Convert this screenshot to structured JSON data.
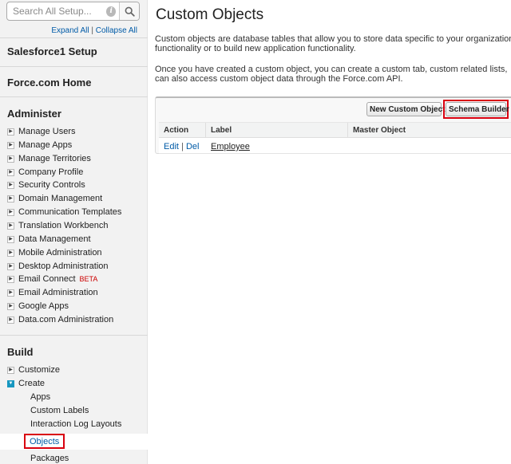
{
  "sidebar": {
    "search_placeholder": "Search All Setup...",
    "expand_all": "Expand All",
    "separator": " | ",
    "collapse_all": "Collapse All",
    "sections": {
      "salesforce1": "Salesforce1 Setup",
      "forcecom": "Force.com Home",
      "administer": "Administer",
      "build": "Build"
    },
    "administer_items": [
      "Manage Users",
      "Manage Apps",
      "Manage Territories",
      "Company Profile",
      "Security Controls",
      "Domain Management",
      "Communication Templates",
      "Translation Workbench",
      "Data Management",
      "Mobile Administration",
      "Desktop Administration",
      "Email Connect",
      "Email Administration",
      "Google Apps",
      "Data.com Administration"
    ],
    "beta_badge": "BETA",
    "build_items": [
      "Customize",
      "Create"
    ],
    "create_sub_items": [
      "Apps",
      "Custom Labels",
      "Interaction Log Layouts"
    ],
    "selected_item": "Objects",
    "after_selected_item": "Packages"
  },
  "main": {
    "title": "Custom Objects",
    "para1_line1": "Custom objects are database tables that allow you to store data specific to your organization",
    "para1_line2": "functionality or to build new application functionality.",
    "para2_line1": "Once you have created a custom object, you can create a custom tab, custom related lists,",
    "para2_line2": "can also access custom object data through the Force.com API.",
    "buttons": {
      "new_custom_object": "New Custom Object",
      "schema_builder": "Schema Builder"
    },
    "table": {
      "headers": [
        "Action",
        "Label",
        "Master Object"
      ],
      "rows": [
        {
          "edit": "Edit",
          "sep": " | ",
          "del": "Del",
          "label": "Employee",
          "master": ""
        }
      ]
    }
  },
  "colors": {
    "highlight_border": "#d9000f",
    "link": "#015ba7",
    "open_twisty": "#1797c0"
  }
}
